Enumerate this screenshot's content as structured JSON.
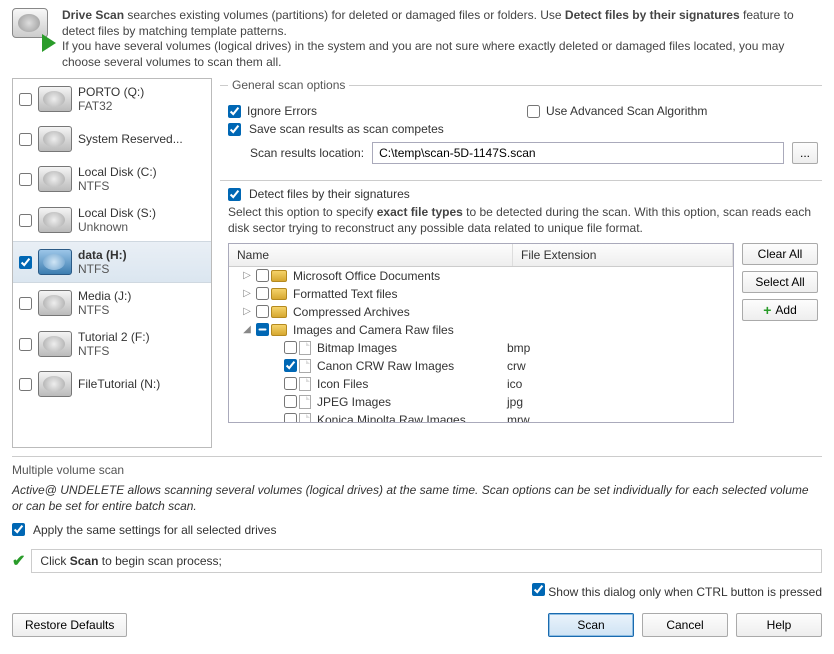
{
  "header": {
    "line1a": "Drive Scan",
    "line1b": " searches existing volumes (partitions) for deleted or damaged files or folders. Use ",
    "line1c": "Detect files by their signatures",
    "line1d": " feature to detect files by matching template patterns.",
    "line2": "If you have several volumes (logical drives) in the system and you are not sure where exactly deleted or damaged files located, you may choose several volumes to scan them all."
  },
  "volumes": [
    {
      "label": "PORTO (Q:)",
      "fs": "FAT32",
      "checked": false,
      "selected": false
    },
    {
      "label": "System Reserved...",
      "fs": "",
      "checked": false,
      "selected": false
    },
    {
      "label": "Local Disk (C:)",
      "fs": "NTFS",
      "checked": false,
      "selected": false
    },
    {
      "label": "Local Disk (S:)",
      "fs": "Unknown",
      "checked": false,
      "selected": false
    },
    {
      "label": "data (H:)",
      "fs": "NTFS",
      "checked": true,
      "selected": true
    },
    {
      "label": "Media (J:)",
      "fs": "NTFS",
      "checked": false,
      "selected": false
    },
    {
      "label": "Tutorial 2 (F:)",
      "fs": "NTFS",
      "checked": false,
      "selected": false
    },
    {
      "label": "FileTutorial (N:)",
      "fs": "",
      "checked": false,
      "selected": false
    }
  ],
  "general": {
    "legend": "General scan options",
    "ignore_errors": "Ignore Errors",
    "advanced": "Use Advanced Scan Algorithm",
    "save_results": "Save scan results as scan competes",
    "results_label": "Scan results location:",
    "results_value": "C:\\temp\\scan-5D-1147S.scan"
  },
  "signatures": {
    "label": "Detect files by their signatures",
    "desc_a": "Select this option to specify ",
    "desc_b": "exact file types",
    "desc_c": " to be detected during the scan. With this option, scan reads each disk sector trying to reconstruct any possible data related to unique file format.",
    "col_name": "Name",
    "col_ext": "File Extension",
    "clear_all": "Clear All",
    "select_all": "Select All",
    "add": "Add"
  },
  "tree": [
    {
      "type": "folder",
      "name": "Microsoft Office Documents",
      "ext": "",
      "expanded": false,
      "indent": 0,
      "checked": false
    },
    {
      "type": "folder",
      "name": "Formatted Text files",
      "ext": "",
      "expanded": false,
      "indent": 0,
      "checked": false
    },
    {
      "type": "folder",
      "name": "Compressed Archives",
      "ext": "",
      "expanded": false,
      "indent": 0,
      "checked": false
    },
    {
      "type": "folder",
      "name": "Images and Camera Raw files",
      "ext": "",
      "expanded": true,
      "indent": 0,
      "checked": "mixed"
    },
    {
      "type": "file",
      "name": "Bitmap Images",
      "ext": "bmp",
      "indent": 1,
      "checked": false
    },
    {
      "type": "file",
      "name": "Canon CRW Raw Images",
      "ext": "crw",
      "indent": 1,
      "checked": true
    },
    {
      "type": "file",
      "name": "Icon Files",
      "ext": "ico",
      "indent": 1,
      "checked": false
    },
    {
      "type": "file",
      "name": "JPEG Images",
      "ext": "jpg",
      "indent": 1,
      "checked": false
    },
    {
      "type": "file",
      "name": "Konica Minolta Raw Images",
      "ext": "mrw",
      "indent": 1,
      "checked": false
    }
  ],
  "multi": {
    "title": "Multiple volume scan",
    "desc": "Active@ UNDELETE allows scanning several volumes (logical drives) at the same time. Scan options can be set individually for each selected volume or can be set for entire batch scan.",
    "same_settings": "Apply the same settings for all selected drives"
  },
  "status": "Click Scan to begin scan process;",
  "dialog_option": "Show this dialog only when CTRL button is pressed",
  "footer": {
    "restore": "Restore Defaults",
    "scan": "Scan",
    "cancel": "Cancel",
    "help": "Help"
  }
}
